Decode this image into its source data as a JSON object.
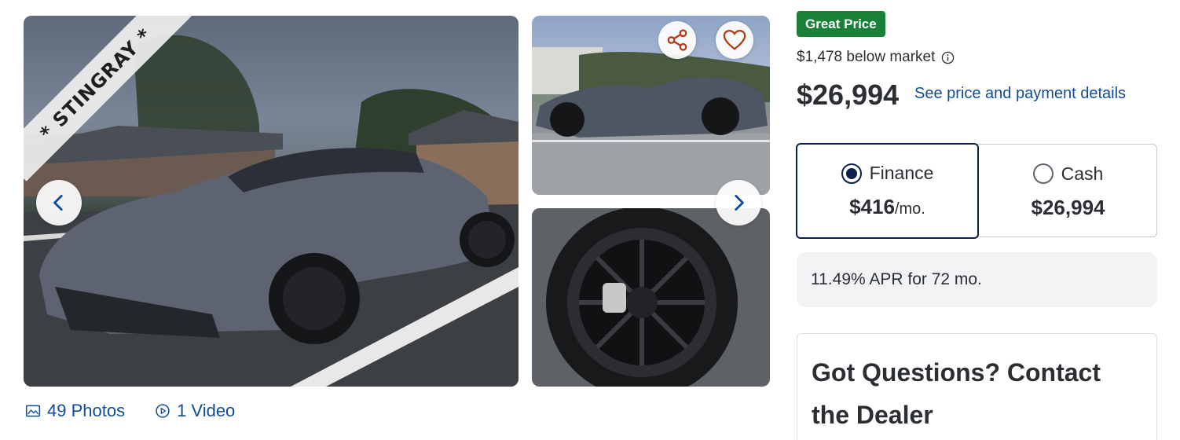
{
  "gallery": {
    "banner_text": "* STINGRAY *",
    "photos_label": "49 Photos",
    "video_label": "1 Video"
  },
  "pricing": {
    "deal_badge": "Great Price",
    "deal_badge_color": "#1a7f37",
    "below_market": "$1,478 below market",
    "price": "$26,994",
    "details_link": "See price and payment details"
  },
  "payment_toggle": {
    "finance": {
      "label": "Finance",
      "amount": "$416",
      "unit": "/mo.",
      "selected": true
    },
    "cash": {
      "label": "Cash",
      "amount": "$26,994",
      "selected": false
    }
  },
  "apr_text": "11.49% APR for 72 mo.",
  "contact": {
    "heading": "Got Questions? Contact the Dealer"
  },
  "colors": {
    "link": "#0f4c9b",
    "selected_border": "#0d1f4d",
    "text": "#2b2e33"
  },
  "icons": [
    "share-icon",
    "heart-icon",
    "chevron-left-icon",
    "chevron-right-icon",
    "image-icon",
    "play-icon",
    "info-icon"
  ]
}
